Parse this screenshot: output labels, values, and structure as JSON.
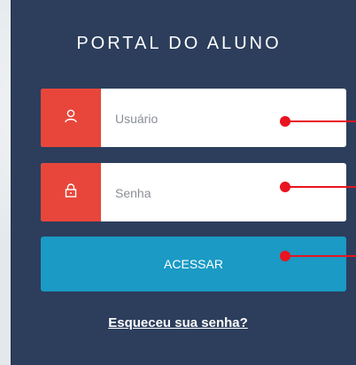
{
  "portal": {
    "title": "PORTAL DO ALUNO"
  },
  "username": {
    "placeholder": "Usuário"
  },
  "password": {
    "placeholder": "Senha"
  },
  "login_button": {
    "label": "ACESSAR"
  },
  "forgot_link": {
    "label": "Esqueceu sua senha?"
  },
  "icons": {
    "user": "user-icon",
    "lock": "lock-icon"
  },
  "colors": {
    "panel": "#2c3e5c",
    "icon_bg": "#e8463a",
    "button": "#1a9ac4",
    "marker": "#e8141e"
  }
}
